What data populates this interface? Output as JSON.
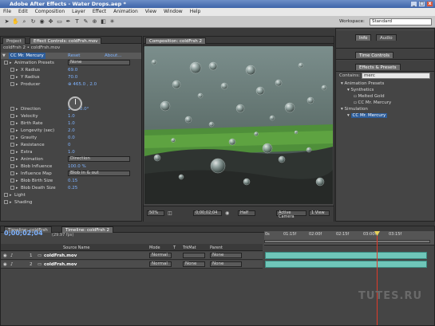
{
  "title_bar": {
    "title": "Adobe After Effects - Water Drops.aep *",
    "btn_min": "_",
    "btn_max": "□",
    "btn_close": "x"
  },
  "menu": [
    "File",
    "Edit",
    "Composition",
    "Layer",
    "Effect",
    "Animation",
    "View",
    "Window",
    "Help"
  ],
  "toolbar": {
    "workspace_label": "Workspace:",
    "workspace_value": "Standard"
  },
  "effect_controls": {
    "tab_project": "Project",
    "tab_effect": "Effect Controls: coldFrsh.mov",
    "subtitle": "coldFrsh 2 • coldFrsh.mov",
    "effect_name": "CC Mr. Mercury",
    "reset": "Reset",
    "about": "About...",
    "props": [
      {
        "label": "Animation Presets",
        "value": "None",
        "indent": 1
      },
      {
        "label": "X Radius",
        "value": "69.0",
        "indent": 2
      },
      {
        "label": "Y Radius",
        "value": "70.0",
        "indent": 2
      },
      {
        "label": "Producer",
        "value": "⊕ 465.0 , 2.0",
        "indent": 2
      },
      {
        "label": "Direction",
        "value": "1 x +0.0°",
        "indent": 2
      },
      {
        "label": "Velocity",
        "value": "1.0",
        "indent": 2
      },
      {
        "label": "Birth Rate",
        "value": "1.0",
        "indent": 2
      },
      {
        "label": "Longevity (sec)",
        "value": "2.0",
        "indent": 2
      },
      {
        "label": "Gravity",
        "value": "0.0",
        "indent": 2
      },
      {
        "label": "Resistance",
        "value": "0",
        "indent": 2
      },
      {
        "label": "Extra",
        "value": "1.0",
        "indent": 2
      },
      {
        "label": "Animation",
        "value": "Direction",
        "indent": 2
      },
      {
        "label": "Blob Influence",
        "value": "100.0 %",
        "indent": 2
      },
      {
        "label": "Influence Map",
        "value": "Blob in & out",
        "indent": 2
      },
      {
        "label": "Blob Birth Size",
        "value": "0.15",
        "indent": 2
      },
      {
        "label": "Blob Death Size",
        "value": "0.25",
        "indent": 2
      },
      {
        "label": "Light",
        "value": "",
        "indent": 1
      },
      {
        "label": "Shading",
        "value": "",
        "indent": 1
      }
    ]
  },
  "composition": {
    "tab": "Composition: coldFrsh 2",
    "bottom_bar": {
      "zoom": "50%",
      "timecode": "0;00;02;04",
      "res": "Half",
      "camera": "Active Camera",
      "view": "1 View"
    }
  },
  "right_panels": {
    "info_tab": "Info",
    "audio_tab": "Audio",
    "time_controls_tab": "Time Controls",
    "effects_tab": "Effects & Presets",
    "contains_label": "Contains:",
    "search_value": "merc",
    "tree": [
      {
        "label": "Animation Presets",
        "indent": 0
      },
      {
        "label": "Synthetics",
        "indent": 1
      },
      {
        "label": "Melted Gold",
        "indent": 2
      },
      {
        "label": "CC Mr. Mercury",
        "indent": 2
      },
      {
        "label": "Simulation",
        "indent": 0
      },
      {
        "label": "CC Mr. Mercury",
        "indent": 1
      }
    ]
  },
  "timeline": {
    "tab1": "Timeline: coldFrsh",
    "tab2": "Timeline: coldFrsh 2",
    "timecode": "0;00;02;04",
    "fps": "(29.97 fps)",
    "headers": [
      "Source Name",
      "Mode",
      "T",
      "TrkMat",
      "Parent"
    ],
    "layers": [
      {
        "num": "1",
        "name": "coldFrsh.mov",
        "mode": "Normal",
        "trkmat": "",
        "parent": "None"
      },
      {
        "num": "2",
        "name": "coldFrsh.mov",
        "mode": "Normal",
        "trkmat": "None",
        "parent": "None"
      }
    ],
    "ruler": [
      "0s",
      "01:15f",
      "02:00f",
      "02:15f",
      "03:00f",
      "03:15f"
    ],
    "watermark": "TUTES.RU"
  },
  "colors": {
    "accent_blue": "#7fb3ff",
    "track": "#6fc6b9",
    "cti": "#e03a2a"
  }
}
